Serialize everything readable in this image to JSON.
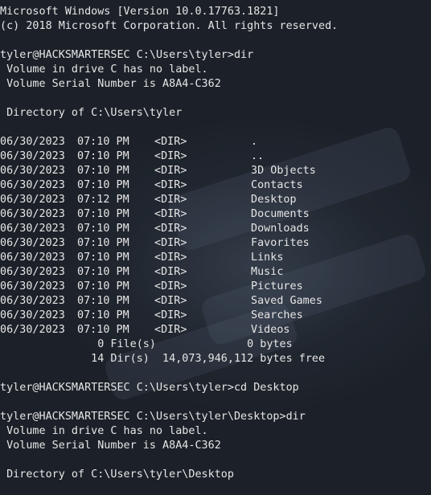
{
  "colors": {
    "background": "#1c2129",
    "text": "#e6e6e6"
  },
  "terminal": {
    "header_line1": "Microsoft Windows [Version 10.0.17763.1821]",
    "header_line2": "(c) 2018 Microsoft Corporation. All rights reserved.",
    "cmd1": "tyler@HACKSMARTERSEC C:\\Users\\tyler>dir",
    "vol_label1": " Volume in drive C has no label.",
    "vol_serial1": " Volume Serial Number is A8A4-C362",
    "dir_of1": " Directory of C:\\Users\\tyler",
    "entries": [
      {
        "date": "06/30/2023",
        "time": "07:10 PM",
        "type": "<DIR>",
        "name": "."
      },
      {
        "date": "06/30/2023",
        "time": "07:10 PM",
        "type": "<DIR>",
        "name": ".."
      },
      {
        "date": "06/30/2023",
        "time": "07:10 PM",
        "type": "<DIR>",
        "name": "3D Objects"
      },
      {
        "date": "06/30/2023",
        "time": "07:10 PM",
        "type": "<DIR>",
        "name": "Contacts"
      },
      {
        "date": "06/30/2023",
        "time": "07:12 PM",
        "type": "<DIR>",
        "name": "Desktop"
      },
      {
        "date": "06/30/2023",
        "time": "07:10 PM",
        "type": "<DIR>",
        "name": "Documents"
      },
      {
        "date": "06/30/2023",
        "time": "07:10 PM",
        "type": "<DIR>",
        "name": "Downloads"
      },
      {
        "date": "06/30/2023",
        "time": "07:10 PM",
        "type": "<DIR>",
        "name": "Favorites"
      },
      {
        "date": "06/30/2023",
        "time": "07:10 PM",
        "type": "<DIR>",
        "name": "Links"
      },
      {
        "date": "06/30/2023",
        "time": "07:10 PM",
        "type": "<DIR>",
        "name": "Music"
      },
      {
        "date": "06/30/2023",
        "time": "07:10 PM",
        "type": "<DIR>",
        "name": "Pictures"
      },
      {
        "date": "06/30/2023",
        "time": "07:10 PM",
        "type": "<DIR>",
        "name": "Saved Games"
      },
      {
        "date": "06/30/2023",
        "time": "07:10 PM",
        "type": "<DIR>",
        "name": "Searches"
      },
      {
        "date": "06/30/2023",
        "time": "07:10 PM",
        "type": "<DIR>",
        "name": "Videos"
      }
    ],
    "files_summary": "               0 File(s)              0 bytes",
    "dirs_summary": "              14 Dir(s)  14,073,946,112 bytes free",
    "cmd2": "tyler@HACKSMARTERSEC C:\\Users\\tyler>cd Desktop",
    "cmd3": "tyler@HACKSMARTERSEC C:\\Users\\tyler\\Desktop>dir",
    "vol_label2": " Volume in drive C has no label.",
    "vol_serial2": " Volume Serial Number is A8A4-C362",
    "dir_of2": " Directory of C:\\Users\\tyler\\Desktop"
  }
}
